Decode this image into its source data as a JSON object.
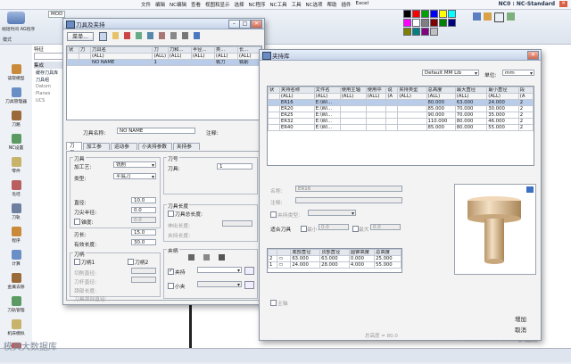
{
  "app": {
    "title": "NC0 : NC-Standard",
    "menu": [
      "文件",
      "编辑",
      "NC编辑",
      "查看",
      "视图和显示",
      "选择",
      "NC程序",
      "NC工具",
      "工具",
      "NC选项",
      "帮助",
      "插件",
      "Excel"
    ],
    "model_tab": "MOD",
    "left_combo_label": "模式",
    "left_combo_value": "装配",
    "left_tool_label": "缩短时间 AG程序",
    "feature_label": "特征",
    "feature_tree_header": "集成",
    "tree_items": [
      "缓存刀具库",
      "刀具组",
      "Datum",
      "Planes",
      "UCS"
    ],
    "sidebar_items": [
      "读取模型",
      "刀具管理器",
      "刀路",
      "NC设置",
      "零件",
      "毛坯",
      "刀轨",
      "程序",
      "计算",
      "金属去除",
      "刀轨管理",
      "机床模拟",
      "验证后处理"
    ]
  },
  "tools_window": {
    "title": "刀具及夹持",
    "menu_button": "菜单...",
    "grid": {
      "headers": [
        "状",
        "刀",
        "刀具名",
        "刀",
        "刀和...",
        "半径...",
        "类...",
        "长..."
      ],
      "filter_row": [
        "",
        "",
        "(ALL)",
        "(ALL)",
        "(ALL)",
        "(ALL)",
        "(ALL)",
        "(ALL)"
      ],
      "rows": [
        [
          "",
          "",
          "NO NAME",
          "1",
          "",
          "",
          "铣刀",
          "铣削"
        ]
      ]
    },
    "name_label": "刀具名称:",
    "name_value": "NO NAME",
    "comment_label": "注释:",
    "tabs": [
      "刀具",
      "加工参数",
      "运动参数",
      "小夹持参数",
      "夹持参数"
    ],
    "cutter_group": "刀具",
    "process_label": "加工艺:",
    "process_value": "铣削",
    "type_label": "类型:",
    "type_value": "平底刀",
    "diameter_label": "直径:",
    "diameter_value": "10.0",
    "corner_radius_label": "刀尖半径:",
    "corner_radius_value": "0.0",
    "taper_label": "锥度:",
    "taper_value": "0.0",
    "flute_label": "刃长:",
    "flute_value": "15.0",
    "effective_label": "有效长度:",
    "effective_value": "30.0",
    "number_group": "刀号",
    "number_label": "刀具:",
    "number_value": "1",
    "length_group": "刀具长度",
    "length_check": "刀具总长度:",
    "overhang_label": "伸出长度:",
    "holder_len_label": "夹持长度:",
    "cutter_sub_group": "刀柄",
    "cutter1": "刀柄1",
    "cutter2": "刀柄2",
    "cut_dia_label": "切削直径:",
    "shank_dia_label": "刀杆直径:",
    "neck_label": "颈部长度:",
    "neck_dia_label": "刀具颈部直径:",
    "holder_group": "夹柄",
    "holder_label": "夹持",
    "collet_label": "小夹"
  },
  "holder_window": {
    "title": "夹持库",
    "library": "Default MM Lib",
    "unit_label": "单位:",
    "unit_value": "mm",
    "grid": {
      "headers": [
        "状",
        "夹持名称",
        "文件名",
        "使用主轴",
        "使用中",
        "说",
        "夹持类型",
        "总高度",
        "最大直径",
        "最小直径",
        "段"
      ],
      "filter_row": [
        "",
        "(ALL)",
        "(ALL)",
        "(ALL)",
        "(ALL)",
        "(A",
        "(ALL)",
        "(ALL)",
        "(ALL)",
        "(ALL)",
        "(A"
      ],
      "rows": [
        [
          "",
          "ER16",
          "E:\\Wi...",
          "",
          "",
          "",
          "",
          "80.000",
          "63.000",
          "24.000",
          "2"
        ],
        [
          "",
          "ER20",
          "E:\\Wi...",
          "",
          "",
          "",
          "",
          "85.000",
          "70.000",
          "30.000",
          "2"
        ],
        [
          "",
          "ER25",
          "E:\\Wi...",
          "",
          "",
          "",
          "",
          "90.000",
          "70.000",
          "35.000",
          "2"
        ],
        [
          "",
          "ER32",
          "E:\\Wi...",
          "",
          "",
          "",
          "",
          "110.000",
          "80.000",
          "46.000",
          "2"
        ],
        [
          "",
          "ER40",
          "E:\\Wi...",
          "",
          "",
          "",
          "",
          "85.000",
          "80.000",
          "55.000",
          "2"
        ]
      ]
    },
    "name_label": "名称:",
    "name_value": "ER16",
    "comment_label": "注释:",
    "type_check": "夹持类型:",
    "offset_label": "适合刀具",
    "min_label": "最小",
    "min_value": "0.0",
    "max_label": "最大",
    "max_value": "0.0",
    "seg_grid": {
      "headers": [
        "",
        "",
        "底部直径",
        "顶部直径",
        "圆锥高度",
        "总高度"
      ],
      "rows": [
        [
          "2",
          "▭",
          "63.000",
          "63.000",
          "0.000",
          "25.000"
        ],
        [
          "1",
          "▭",
          "24.000",
          "28.000",
          "4.000",
          "55.000"
        ]
      ]
    },
    "main_check": "主轴",
    "add_button": "增加",
    "cancel_button": "取消",
    "status_text": "总高度 = 80.0"
  },
  "watermark": {
    "left": "模具大数据库",
    "right": "Cimatron联赢"
  },
  "colors": {
    "palette": [
      "#000000",
      "#ff0000",
      "#00a000",
      "#0000ff",
      "#ffff00",
      "#00ffff",
      "#ff00ff",
      "#ffffff",
      "#808080",
      "#800000",
      "#008000",
      "#000080",
      "#808000",
      "#008080",
      "#800080",
      "#c0c0c0"
    ],
    "selection": "#b9cdea",
    "holder_body": "#e8cfa8"
  }
}
